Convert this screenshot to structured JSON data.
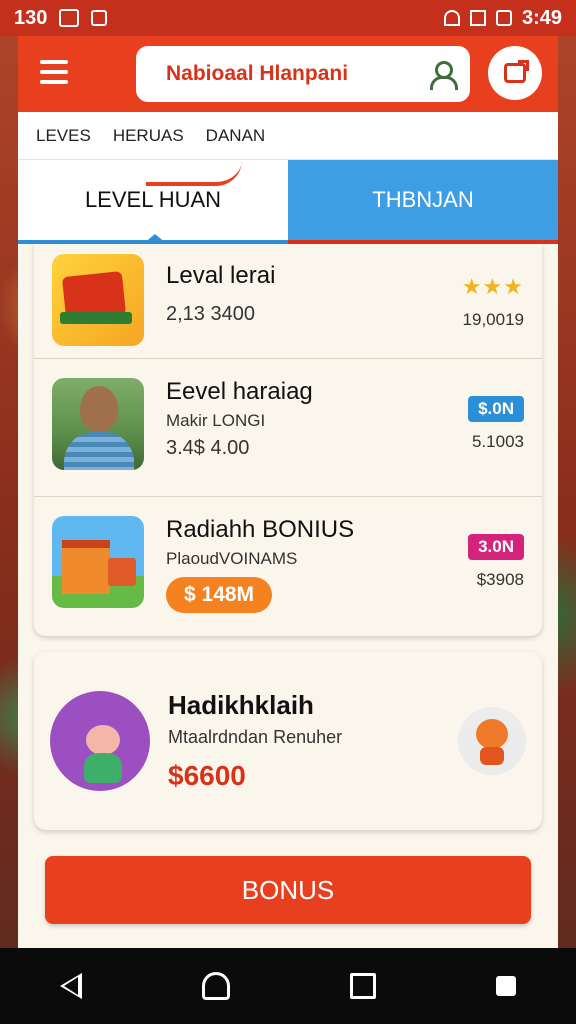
{
  "status_bar": {
    "time_left": "130",
    "time_right": "3:49"
  },
  "header": {
    "search_text": "Nabioaal Hlanpani",
    "menu_icon": "menu-icon",
    "user_icon": "user-icon",
    "share_icon": "share-icon"
  },
  "subnav": {
    "items": [
      "LEVES",
      "HERUAS",
      "DANAN"
    ]
  },
  "tabs": [
    {
      "label": "LEVEL HUAN",
      "active": true
    },
    {
      "label": "THBNJAN",
      "active": false
    }
  ],
  "list": [
    {
      "title": "Leval lerai",
      "value": "2,13 3400",
      "stars": "★★★",
      "right_value": "19,0019",
      "thumb": "game-icon"
    },
    {
      "title": "Eevel haraiag",
      "subtitle": "Makir LONGI",
      "value": "3.4$ 4.00",
      "badge": "$.0N",
      "badge_color": "#2a8fd6",
      "right_value": "5.1003",
      "thumb": "person-photo"
    },
    {
      "title": "Radiahh BONIUS",
      "subtitle": "PlaoudVOINAMS",
      "pill": "$ 148M",
      "badge": "3.0N",
      "badge_color": "#d4237a",
      "right_value": "$3908",
      "thumb": "house-icon"
    }
  ],
  "bonus_card": {
    "title": "Hadikhklaih",
    "subtitle": "Mtaalrdndan Renuher",
    "value": "$6600"
  },
  "bonus_button": {
    "label": "BONUS"
  },
  "colors": {
    "primary": "#e8401f",
    "accent_blue": "#3d9ee3",
    "star": "#f0b51e",
    "pill": "#f58220"
  }
}
